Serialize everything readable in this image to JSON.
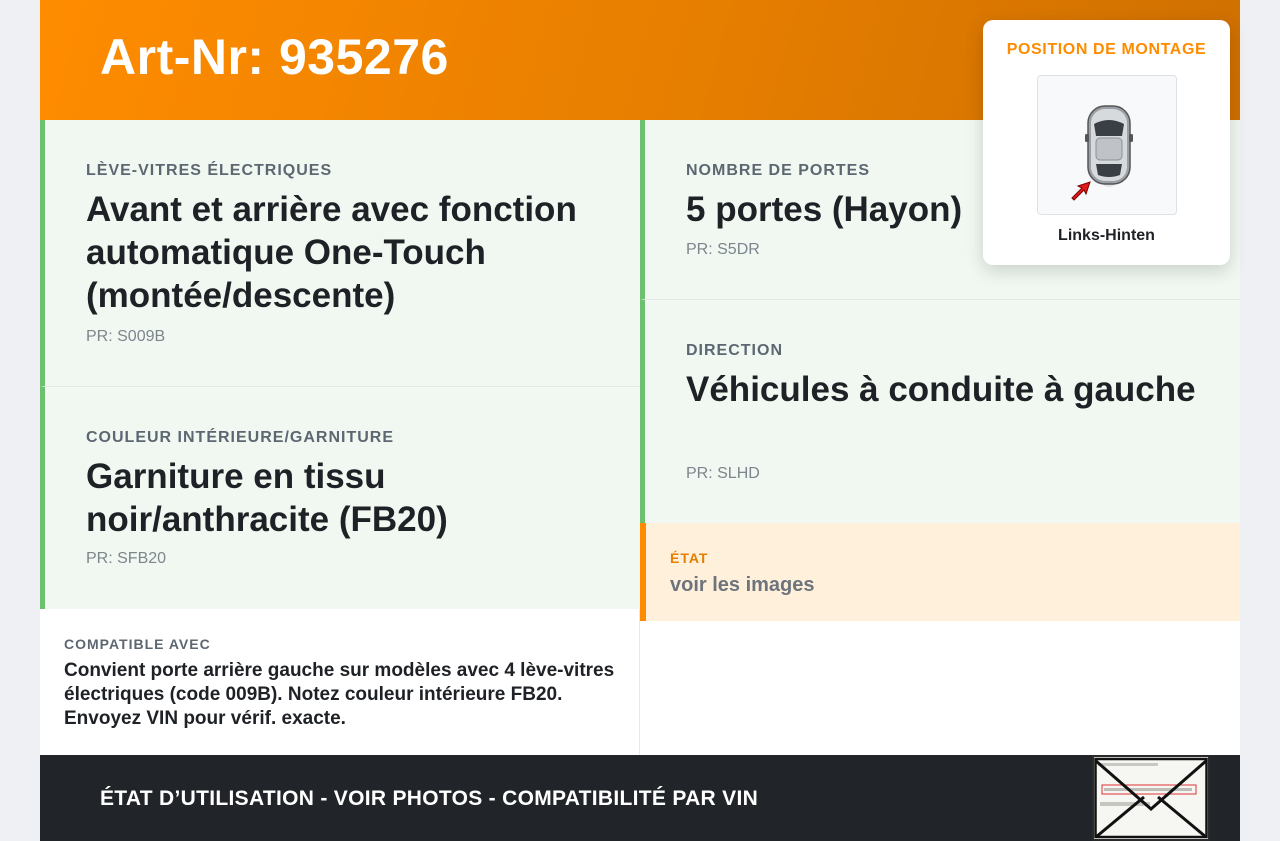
{
  "header": {
    "article": "Art-Nr: 935276"
  },
  "cards": {
    "windows": {
      "label": "LÈVE-VITRES ÉLECTRIQUES",
      "value": "Avant et arrière avec fonction automatique One-Touch (montée/descente)",
      "pr": "PR: S009B"
    },
    "interior": {
      "label": "COULEUR INTÉRIEURE/GARNITURE",
      "value": "Garniture en tissu noir/anthracite (FB20)",
      "pr": "PR: SFB20"
    },
    "doors": {
      "label": "NOMBRE DE PORTES",
      "value": "5 portes (Hayon)",
      "pr": "PR: S5DR"
    },
    "steering": {
      "label": "DIRECTION",
      "value": "Véhicules à conduite à gauche",
      "pr": "PR: SLHD"
    }
  },
  "etat": {
    "label": "ÉTAT",
    "value": "voir les images"
  },
  "compat": {
    "label": "COMPATIBLE AVEC",
    "value": "Convient porte arrière gauche sur modèles avec 4 lève-vitres électriques (code 009B). Notez couleur intérieure FB20. Envoyez VIN pour vérif. exacte."
  },
  "footer": {
    "text": "ÉTAT D’UTILISATION - VOIR PHOTOS - COMPATIBILITÉ PAR VIN"
  },
  "mounting": {
    "title": "POSITION DE MONTAGE",
    "position": "Links-Hinten",
    "icon": "car-top-view-icon"
  },
  "colors": {
    "accent": "#ff8c00",
    "green_border": "#6cc070",
    "card_bg": "#f1f8f1",
    "footer_bg": "#212529"
  }
}
